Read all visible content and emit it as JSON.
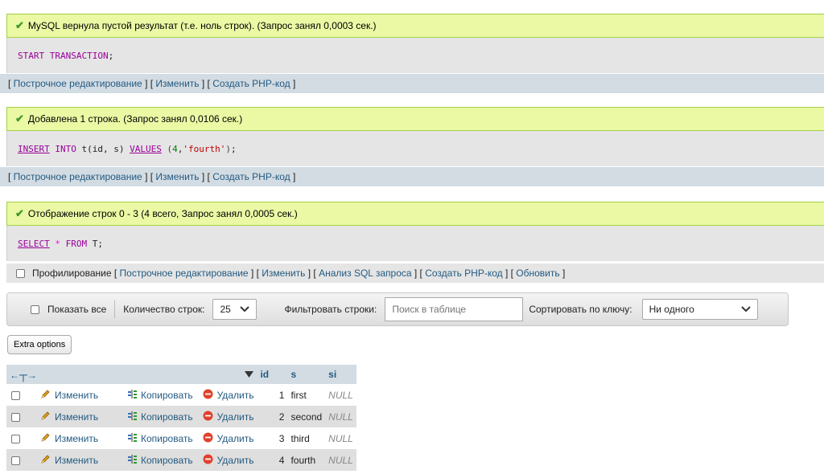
{
  "blocks": [
    {
      "message": "MySQL вернула пустой результат (т.е. ноль строк). (Запрос занял 0,0003 сек.)",
      "sql": "START TRANSACTION;"
    },
    {
      "message": "Добавлена 1 строка. (Запрос занял 0,0106 сек.)",
      "sql": "INSERT INTO t(id, s) VALUES (4, 'fourth');"
    },
    {
      "message": "Отображение строк 0 - 3 (4 всего, Запрос занял 0,0005 сек.)",
      "sql": "SELECT * FROM T;"
    }
  ],
  "links": {
    "inline_edit": "Построчное редактирование",
    "edit": "Изменить",
    "create_php": "Создать PHP-код",
    "profiling": "Профилирование",
    "analyze_sql": "Анализ SQL запроса",
    "refresh": "Обновить"
  },
  "navigation": {
    "show_all": "Показать все",
    "row_count_label": "Количество строк:",
    "row_count_value": "25",
    "filter_label": "Фильтровать строки:",
    "filter_placeholder": "Поиск в таблице",
    "sort_label": "Сортировать по ключу:",
    "sort_value": "Ни одного"
  },
  "extra_options": "Extra options",
  "table": {
    "columns": [
      "id",
      "s",
      "si"
    ],
    "actions": {
      "edit": "Изменить",
      "copy": "Копировать",
      "delete": "Удалить"
    },
    "rows": [
      {
        "id": "1",
        "s": "first",
        "si": "NULL"
      },
      {
        "id": "2",
        "s": "second",
        "si": "NULL"
      },
      {
        "id": "3",
        "s": "third",
        "si": "NULL"
      },
      {
        "id": "4",
        "s": "fourth",
        "si": "NULL"
      }
    ]
  }
}
